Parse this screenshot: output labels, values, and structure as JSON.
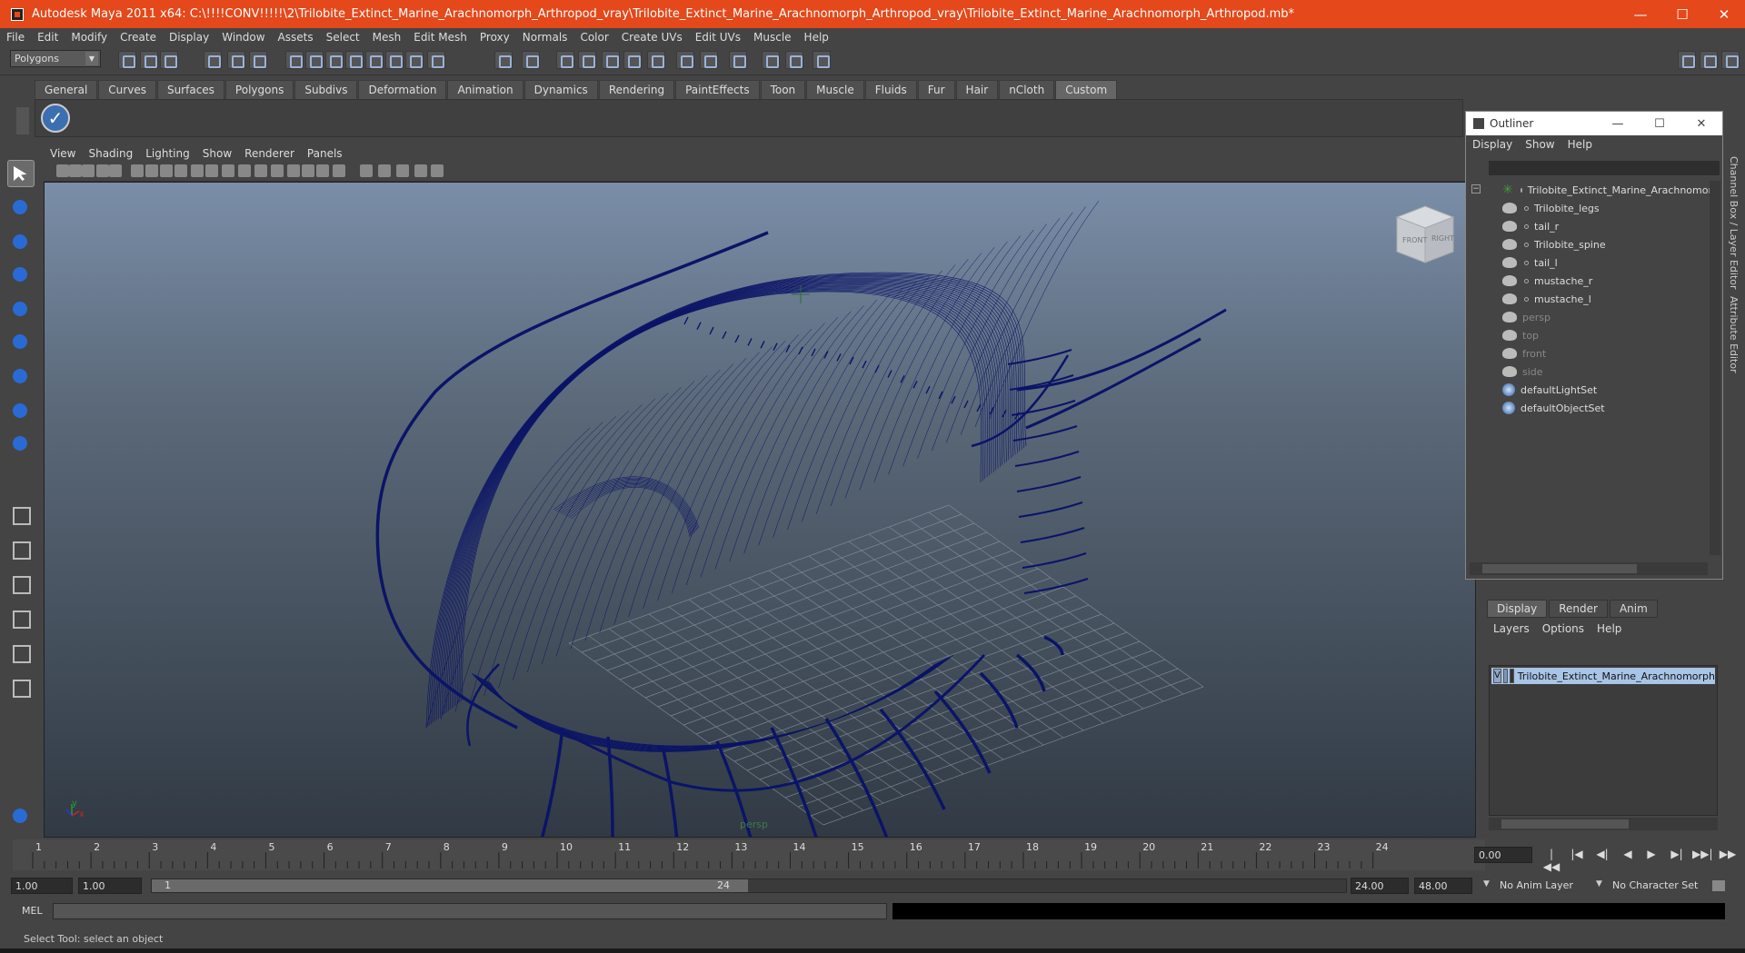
{
  "window": {
    "title": "Autodesk Maya 2011 x64: C:\\!!!!CONV!!!!!\\2\\Trilobite_Extinct_Marine_Arachnomorph_Arthropod_vray\\Trilobite_Extinct_Marine_Arachnomorph_Arthropod_vray\\Trilobite_Extinct_Marine_Arachnomorph_Arthropod.mb*",
    "buttons": {
      "minimize": "—",
      "maximize": "☐",
      "close": "✕"
    }
  },
  "menubar": [
    "File",
    "Edit",
    "Modify",
    "Create",
    "Display",
    "Window",
    "Assets",
    "Select",
    "Mesh",
    "Edit Mesh",
    "Proxy",
    "Normals",
    "Color",
    "Create UVs",
    "Edit UVs",
    "Muscle",
    "Help"
  ],
  "status_line": {
    "mode": "Polygons"
  },
  "shelf": {
    "tabs": [
      "General",
      "Curves",
      "Surfaces",
      "Polygons",
      "Subdivs",
      "Deformation",
      "Animation",
      "Dynamics",
      "Rendering",
      "PaintEffects",
      "Toon",
      "Muscle",
      "Fluids",
      "Fur",
      "Hair",
      "nCloth",
      "Custom"
    ],
    "active_tab": "Custom",
    "check_icon": "✓"
  },
  "panel_menu": [
    "View",
    "Shading",
    "Lighting",
    "Show",
    "Renderer",
    "Panels"
  ],
  "viewport": {
    "camera_label": "persp",
    "viewcube": {
      "front": "FRONT",
      "right": "RIGHT"
    },
    "axis": {
      "x": "x",
      "y": "y"
    },
    "wire_color": "#0b1466"
  },
  "outliner": {
    "title": "Outliner",
    "menu": [
      "Display",
      "Show",
      "Help"
    ],
    "items": [
      {
        "label": "Trilobite_Extinct_Marine_Arachnomorph",
        "icon": "group-star-icon",
        "indent": 0,
        "dim": false
      },
      {
        "label": "Trilobite_legs",
        "icon": "mesh-icon",
        "indent": 1,
        "dim": false
      },
      {
        "label": "tail_r",
        "icon": "mesh-icon",
        "indent": 1,
        "dim": false
      },
      {
        "label": "Trilobite_spine",
        "icon": "mesh-icon",
        "indent": 1,
        "dim": false
      },
      {
        "label": "tail_l",
        "icon": "mesh-icon",
        "indent": 1,
        "dim": false
      },
      {
        "label": "mustache_r",
        "icon": "mesh-icon",
        "indent": 1,
        "dim": false
      },
      {
        "label": "mustache_l",
        "icon": "mesh-icon",
        "indent": 1,
        "dim": false
      },
      {
        "label": "persp",
        "icon": "camera-icon",
        "indent": 0,
        "dim": true
      },
      {
        "label": "top",
        "icon": "camera-icon",
        "indent": 0,
        "dim": true
      },
      {
        "label": "front",
        "icon": "camera-icon",
        "indent": 0,
        "dim": true
      },
      {
        "label": "side",
        "icon": "camera-icon",
        "indent": 0,
        "dim": true
      },
      {
        "label": "defaultLightSet",
        "icon": "set-icon",
        "indent": 0,
        "dim": false
      },
      {
        "label": "defaultObjectSet",
        "icon": "set-icon",
        "indent": 0,
        "dim": false
      }
    ]
  },
  "side_tabs": {
    "channel_box": "Channel Box / Layer Editor",
    "attribute_editor": "Attribute Editor"
  },
  "layer_editor": {
    "tabs": [
      "Display",
      "Render",
      "Anim"
    ],
    "active_tab": "Display",
    "menu": [
      "Layers",
      "Options",
      "Help"
    ],
    "layer": {
      "visible": "V",
      "name": "Trilobite_Extinct_Marine_Arachnomorph"
    }
  },
  "time_slider": {
    "ticks": [
      "1",
      "2",
      "3",
      "4",
      "5",
      "6",
      "7",
      "8",
      "9",
      "10",
      "11",
      "12",
      "13",
      "14",
      "15",
      "16",
      "17",
      "18",
      "19",
      "20",
      "21",
      "22",
      "23",
      "24"
    ],
    "current_time": "0.00",
    "playback_buttons": [
      "|◀◀",
      "|◀",
      "◀|",
      "◀",
      "▶",
      "▶|",
      "▶▶|",
      "▶▶"
    ]
  },
  "range_slider": {
    "start": "1.00",
    "playback_start": "1.00",
    "range_start_label": "1",
    "range_end_label": "24",
    "playback_end": "24.00",
    "end": "48.00",
    "anim_layer": "No Anim Layer",
    "character_set": "No Character Set"
  },
  "command_line": {
    "label": "MEL"
  },
  "help_line": "Select Tool: select an object"
}
